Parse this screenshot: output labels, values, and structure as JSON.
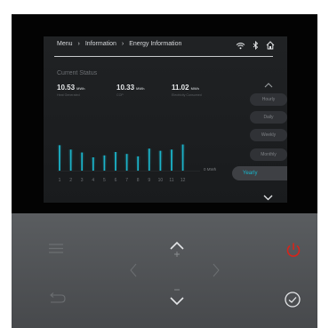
{
  "header": {
    "breadcrumb": [
      "Menu",
      "Information",
      "Energy Information"
    ],
    "separator": "›",
    "icons": [
      "wifi-icon",
      "bluetooth-icon",
      "home-icon"
    ]
  },
  "status": {
    "title": "Current Status",
    "stats": [
      {
        "value": "10.53",
        "unit": "MWh",
        "label": "Heat Generated"
      },
      {
        "value": "10.33",
        "unit": "MWh",
        "label": "COP"
      },
      {
        "value": "11.02",
        "unit": "MWh",
        "label": "Electricity Consumed"
      }
    ]
  },
  "chart_data": {
    "type": "bar",
    "categories": [
      "1",
      "2",
      "3",
      "4",
      "5",
      "6",
      "7",
      "8",
      "9",
      "10",
      "11",
      "12"
    ],
    "values": [
      10.5,
      8.7,
      7.5,
      5.5,
      6.3,
      7.7,
      6.9,
      5.9,
      9.1,
      8.2,
      8.7,
      10.8
    ],
    "ylabel": "0 MWh",
    "accent_color": "#1bb3c9"
  },
  "period_tabs": {
    "items": [
      "Hourly",
      "Daily",
      "Weekly",
      "Monthly",
      "Yearly"
    ],
    "selected": "Yearly"
  },
  "controls": {
    "buttons": [
      "menu-icon",
      "up-plus-icon",
      "power-icon",
      "left-icon",
      "right-icon",
      "back-icon",
      "down-minus-icon",
      "confirm-check-icon"
    ],
    "power_color": "#d8231a"
  }
}
